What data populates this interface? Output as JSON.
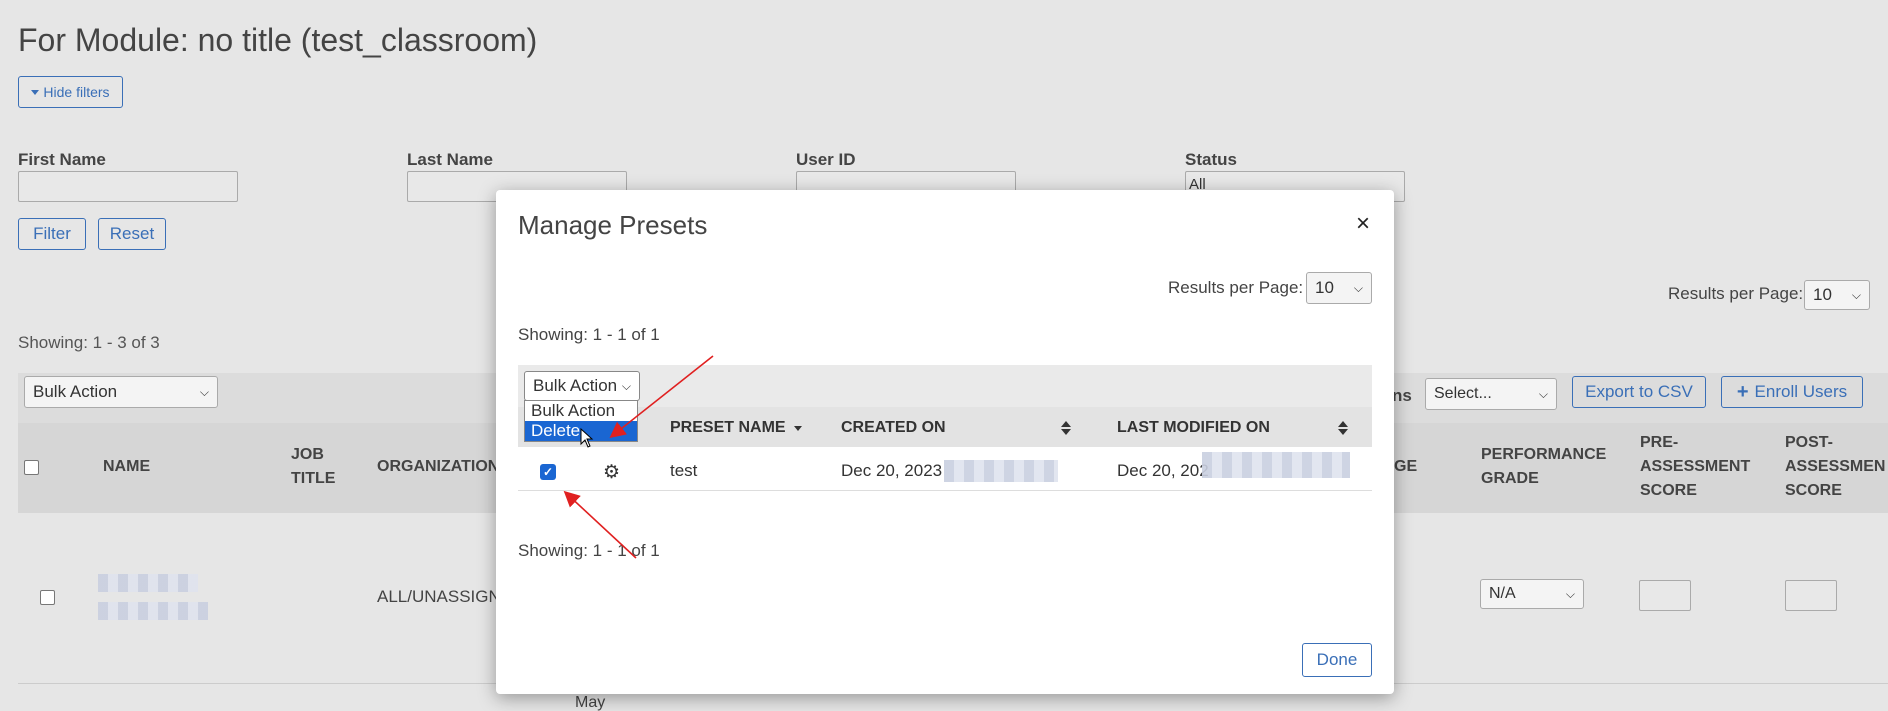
{
  "page": {
    "title": "For Module: no title (test_classroom)",
    "hide_filters": "Hide filters",
    "filters": {
      "first_name_label": "First Name",
      "last_name_label": "Last Name",
      "user_id_label": "User ID",
      "status_label": "Status",
      "status_value": "All",
      "filter_btn": "Filter",
      "reset_btn": "Reset"
    },
    "results_per_page_label": "Results per Page:",
    "results_per_page_value": "10",
    "showing": "Showing: 1 - 3 of 3",
    "bulk_action": "Bulk Action",
    "actions_label_partial": "ns",
    "select_placeholder": "Select...",
    "export_csv": "Export to CSV",
    "enroll_users": "Enroll Users",
    "table_headers": {
      "name": "NAME",
      "job_title_1": "JOB",
      "job_title_2": "TITLE",
      "organization": "ORGANIZATION",
      "ge_partial": "GE",
      "performance_1": "PERFORMANCE",
      "performance_2": "GRADE",
      "pre_1": "PRE-",
      "pre_2": "ASSESSMENT",
      "pre_3": "SCORE",
      "post_1": "POST-",
      "post_2": "ASSESSMEN",
      "post_3": "SCORE"
    },
    "row": {
      "organization": "ALL/UNASSIGN",
      "grade": "N/A"
    },
    "bottom_partial": "May"
  },
  "modal": {
    "title": "Manage Presets",
    "close": "×",
    "results_per_page_label": "Results per Page:",
    "results_per_page_value": "10",
    "showing_top": "Showing: 1 - 1 of 1",
    "bulk_action": "Bulk Action",
    "dropdown_options": [
      "Bulk Action",
      "Delete"
    ],
    "headers": {
      "preset_name": "PRESET NAME",
      "created_on": "CREATED ON",
      "last_modified_on": "LAST MODIFIED ON"
    },
    "row": {
      "name": "test",
      "created_on": "Dec 20, 2023",
      "last_modified_on": "Dec 20, 202"
    },
    "showing_bottom": "Showing: 1 - 1 of 1",
    "done": "Done"
  },
  "colors": {
    "accent": "#3a6fb7",
    "selected": "#1a66d2",
    "annotation_arrow": "#e02020"
  }
}
